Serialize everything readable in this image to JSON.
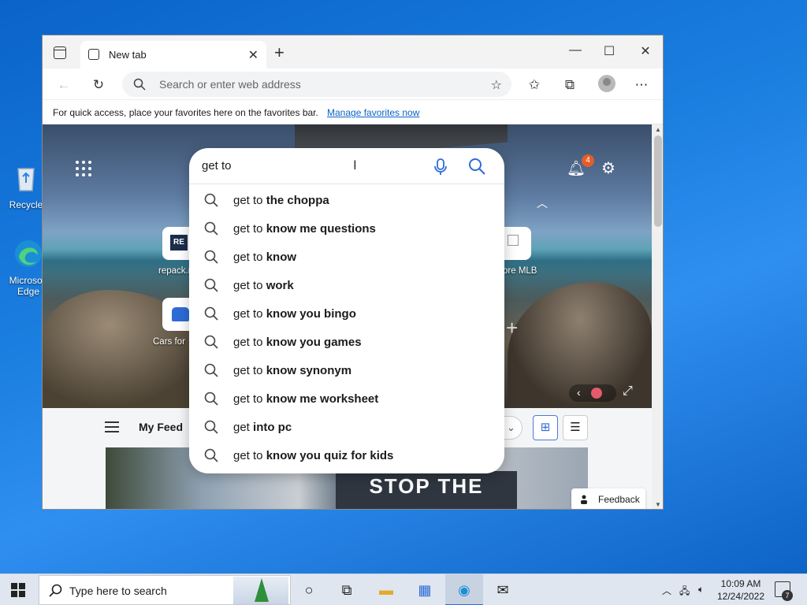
{
  "desktop": {
    "icons": [
      {
        "label": "Recycle",
        "icon": "recycle-bin-icon"
      },
      {
        "label": "Microsoft Edge",
        "icon": "edge-icon"
      }
    ]
  },
  "browser": {
    "tab": {
      "title": "New tab",
      "icon": "newtab-page-icon"
    },
    "window_controls": {
      "minimize": "—",
      "maximize": "☐",
      "close": "✕"
    },
    "address_bar": {
      "placeholder": "Search or enter web address"
    },
    "favorites_bar": {
      "message": "For quick access, place your favorites here on the favorites bar.",
      "link": "Manage favorites now"
    }
  },
  "newtab": {
    "notification_count": "4",
    "quick_links": [
      {
        "label": "repack.r",
        "icon": "repack-site-icon"
      },
      {
        "label": "ore MLB",
        "icon": "broken-image-icon"
      },
      {
        "label": "Cars for",
        "icon": "car-icon"
      }
    ],
    "feed": {
      "label": "My Feed",
      "image_text": "STOP THE",
      "feedback": "Feedback"
    }
  },
  "search": {
    "query": "get to",
    "suggestions": [
      {
        "prefix": "get to ",
        "bold": "the choppa"
      },
      {
        "prefix": "get to ",
        "bold": "know me questions"
      },
      {
        "prefix": "get to ",
        "bold": "know"
      },
      {
        "prefix": "get to ",
        "bold": "work"
      },
      {
        "prefix": "get to ",
        "bold": "know you bingo"
      },
      {
        "prefix": "get to ",
        "bold": "know you games"
      },
      {
        "prefix": "get to ",
        "bold": "know synonym"
      },
      {
        "prefix": "get to ",
        "bold": "know me worksheet"
      },
      {
        "prefix": "get ",
        "bold": "into pc"
      },
      {
        "prefix": "get to ",
        "bold": "know you quiz for kids"
      }
    ]
  },
  "taskbar": {
    "search_placeholder": "Type here to search",
    "clock": {
      "time": "10:09 AM",
      "date": "12/24/2022"
    },
    "notification_count": "7",
    "colors": {
      "accent": "#2b6bd8"
    }
  }
}
